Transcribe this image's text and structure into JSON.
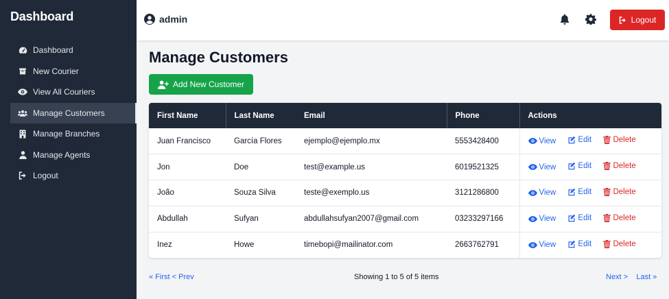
{
  "sidebar": {
    "title": "Dashboard",
    "items": [
      {
        "label": "Dashboard",
        "icon": "gauge-icon"
      },
      {
        "label": "New Courier",
        "icon": "box-icon"
      },
      {
        "label": "View All Couriers",
        "icon": "eye-icon"
      },
      {
        "label": "Manage Customers",
        "icon": "users-icon",
        "active": true
      },
      {
        "label": "Manage Branches",
        "icon": "building-icon"
      },
      {
        "label": "Manage Agents",
        "icon": "user-icon"
      },
      {
        "label": "Logout",
        "icon": "sign-out-icon"
      }
    ]
  },
  "header": {
    "username": "admin",
    "logout_label": "Logout"
  },
  "main": {
    "title": "Manage Customers",
    "add_button_label": "Add New Customer"
  },
  "table": {
    "columns": [
      "First Name",
      "Last Name",
      "Email",
      "Phone",
      "Actions"
    ],
    "rows": [
      {
        "first": "Juan Francisco",
        "last": "García Flores",
        "email": "ejemplo@ejemplo.mx",
        "phone": "5553428400"
      },
      {
        "first": "Jon",
        "last": "Doe",
        "email": "test@example.us",
        "phone": "6019521325"
      },
      {
        "first": "João",
        "last": "Souza Silva",
        "email": "teste@exemplo.us",
        "phone": "3121286800"
      },
      {
        "first": "Abdullah",
        "last": "Sufyan",
        "email": "abdullahsufyan2007@gmail.com",
        "phone": "03233297166"
      },
      {
        "first": "Inez",
        "last": "Howe",
        "email": "timebopi@mailinator.com",
        "phone": "2663762791"
      }
    ],
    "actions": {
      "view": "View",
      "edit": "Edit",
      "delete": "Delete"
    }
  },
  "pagination": {
    "first": "« First",
    "prev": "< Prev",
    "status": "Showing 1 to 5 of 5 items",
    "next": "Next >",
    "last": "Last »"
  },
  "colors": {
    "sidebar_bg": "#1f2937",
    "primary_blue": "#2563eb",
    "success_green": "#16a34a",
    "danger_red": "#dc2626"
  }
}
